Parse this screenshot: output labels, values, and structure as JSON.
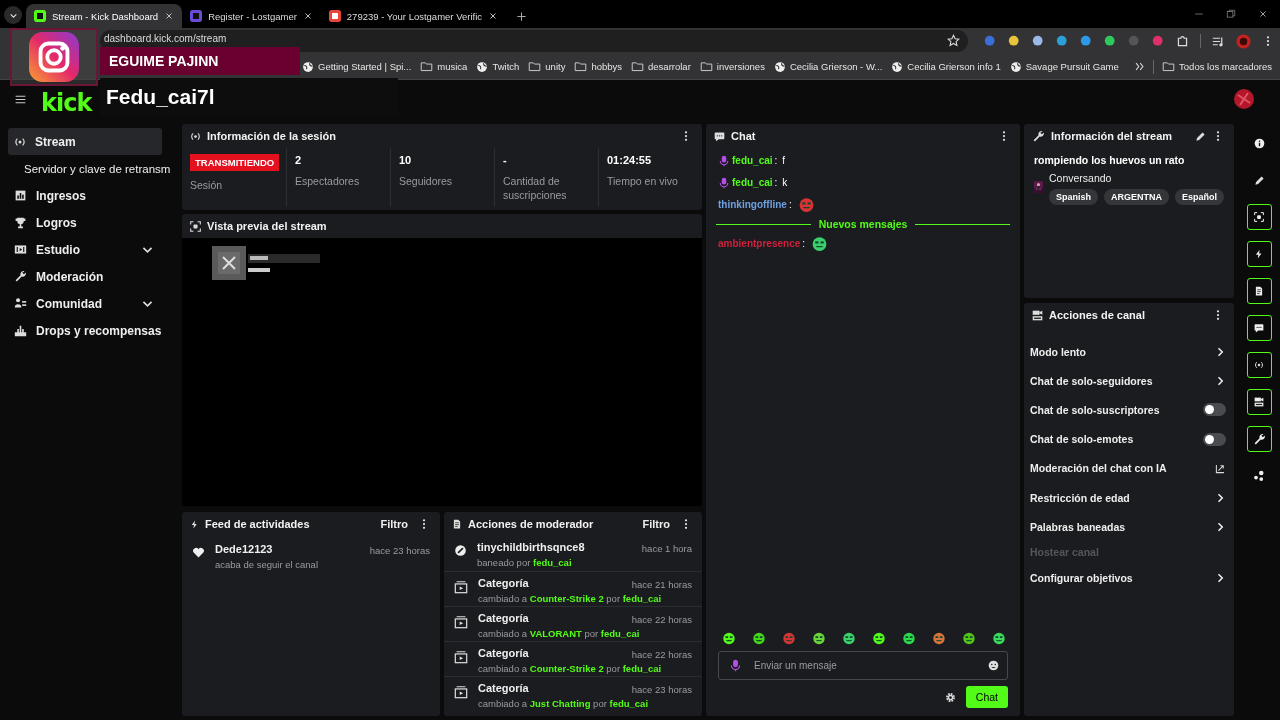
{
  "browser": {
    "tabs": [
      {
        "title": "Stream - Kick Dashboard",
        "selected": true
      },
      {
        "title": "Register - Lostgamer",
        "selected": false
      },
      {
        "title": "279239 - Your Lostgamer Verific",
        "selected": false
      }
    ],
    "url": "dashboard.kick.com/stream",
    "bookmarks": [
      {
        "label": "Getting Started | Spi...",
        "kind": "site"
      },
      {
        "label": "musica",
        "kind": "folder"
      },
      {
        "label": "Twitch",
        "kind": "site"
      },
      {
        "label": "unity",
        "kind": "folder"
      },
      {
        "label": "hobbys",
        "kind": "folder"
      },
      {
        "label": "desarrolar",
        "kind": "folder"
      },
      {
        "label": "inversiones",
        "kind": "folder"
      },
      {
        "label": "Cecilia Grierson - W...",
        "kind": "site"
      },
      {
        "label": "Cecilia Grierson info 1",
        "kind": "site"
      },
      {
        "label": "Savage Pursuit Game",
        "kind": "site"
      }
    ],
    "all_bookmarks": "Todos los marcadores"
  },
  "overlay": {
    "banner": "EGUIME PAJINN",
    "name": "Fedu_cai7l"
  },
  "header": {
    "logo": "kick"
  },
  "sidebar": {
    "items": [
      {
        "label": "Stream",
        "kind": "link",
        "selected": true
      },
      {
        "label": "Servidor y clave de retransm",
        "kind": "sub",
        "selected": false
      },
      {
        "label": "Ingresos",
        "kind": "link",
        "selected": false
      },
      {
        "label": "Logros",
        "kind": "link",
        "selected": false
      },
      {
        "label": "Estudio",
        "kind": "group",
        "selected": false,
        "expanded": false
      },
      {
        "label": "Moderación",
        "kind": "link",
        "selected": false
      },
      {
        "label": "Comunidad",
        "kind": "group",
        "selected": false,
        "expanded": false
      },
      {
        "label": "Drops y recompensas",
        "kind": "link",
        "selected": false
      }
    ]
  },
  "session": {
    "title": "Información de la sesión",
    "badge": "TRANSMITIENDO",
    "badge_label": "Sesión",
    "stats": [
      {
        "value": "2",
        "label": "Espectadores"
      },
      {
        "value": "10",
        "label": "Seguidores"
      },
      {
        "value": "-",
        "label": "Cantidad de suscripciones"
      },
      {
        "value": "01:24:55",
        "label": "Tiempo en vivo"
      }
    ]
  },
  "preview": {
    "title": "Vista previa del stream",
    "kind": "picture"
  },
  "activity": {
    "title": "Feed de actividades",
    "filter": "Filtro",
    "items": [
      {
        "user": "Dede12123",
        "text": "acaba de seguir el canal",
        "time": "hace 23 horas"
      }
    ]
  },
  "mod_actions": {
    "title": "Acciones de moderador",
    "filter": "Filtro",
    "items": [
      {
        "kind": "ban",
        "title": "tinychildbirthsqnce8",
        "detail": "baneado por **fedu_cai**",
        "time": "hace 1 hora"
      },
      {
        "kind": "category",
        "title": "Categoría",
        "detail": "cambiado a **Counter-Strike 2** por **fedu_cai**",
        "time": "hace 21 horas"
      },
      {
        "kind": "category",
        "title": "Categoría",
        "detail": "cambiado a **VALORANT** por **fedu_cai**",
        "time": "hace 22 horas"
      },
      {
        "kind": "category",
        "title": "Categoría",
        "detail": "cambiado a **Counter-Strike 2** por **fedu_cai**",
        "time": "hace 22 horas"
      },
      {
        "kind": "category",
        "title": "Categoría",
        "detail": "cambiado a **Just Chatting** por **fedu_cai**",
        "time": "hace 23 horas"
      }
    ]
  },
  "chat": {
    "title": "Chat",
    "messages": [
      {
        "user": "fedu_cai",
        "separator": ":",
        "color": "#53fc18",
        "badge": true,
        "kind": "text",
        "text": "f"
      },
      {
        "user": "fedu_cai",
        "separator": ":",
        "color": "#53fc18",
        "badge": true,
        "kind": "text",
        "text": "k"
      },
      {
        "user": "thinkingoffline",
        "separator": ":",
        "color": "#6fa0e0",
        "badge": false,
        "kind": "emote"
      },
      {
        "kind": "divider",
        "text": "Nuevos mensajes"
      },
      {
        "user": "ambientpresence",
        "separator": ":",
        "color": "#d0203c",
        "badge": false,
        "kind": "emote"
      }
    ],
    "placeholder": "Enviar un mensaje",
    "send": "Chat"
  },
  "stream_info": {
    "title": "Información del stream",
    "stream_title": "rompiendo los huevos un rato",
    "category": "Conversando",
    "tags": [
      "Spanish",
      "ARGENTNA",
      "Español"
    ]
  },
  "channel_actions": {
    "title": "Acciones de canal",
    "items": [
      {
        "label": "Modo lento",
        "kind": "link",
        "disabled": false
      },
      {
        "label": "Chat de solo-seguidores",
        "kind": "link",
        "disabled": false
      },
      {
        "label": "Chat de solo-suscriptores",
        "kind": "toggle",
        "disabled": false,
        "on": false
      },
      {
        "label": "Chat de solo-emotes",
        "kind": "toggle",
        "disabled": false,
        "on": false
      },
      {
        "label": "Moderación del chat con IA",
        "kind": "external",
        "disabled": false
      },
      {
        "label": "Restricción de edad",
        "kind": "link",
        "disabled": false
      },
      {
        "label": "Palabras baneadas",
        "kind": "link",
        "disabled": false
      },
      {
        "label": "Hostear canal",
        "kind": "plain",
        "disabled": true
      },
      {
        "label": "Configurar objetivos",
        "kind": "link",
        "disabled": false
      }
    ]
  },
  "rail": [
    {
      "kind": "info",
      "active": false
    },
    {
      "kind": "edit",
      "active": false
    },
    {
      "kind": "preview",
      "active": true
    },
    {
      "kind": "activity",
      "active": true
    },
    {
      "kind": "modlog",
      "active": true
    },
    {
      "kind": "chat",
      "active": true
    },
    {
      "kind": "session",
      "active": true
    },
    {
      "kind": "actions",
      "active": true
    },
    {
      "kind": "tools",
      "active": true
    },
    {
      "kind": "more",
      "active": false
    }
  ]
}
